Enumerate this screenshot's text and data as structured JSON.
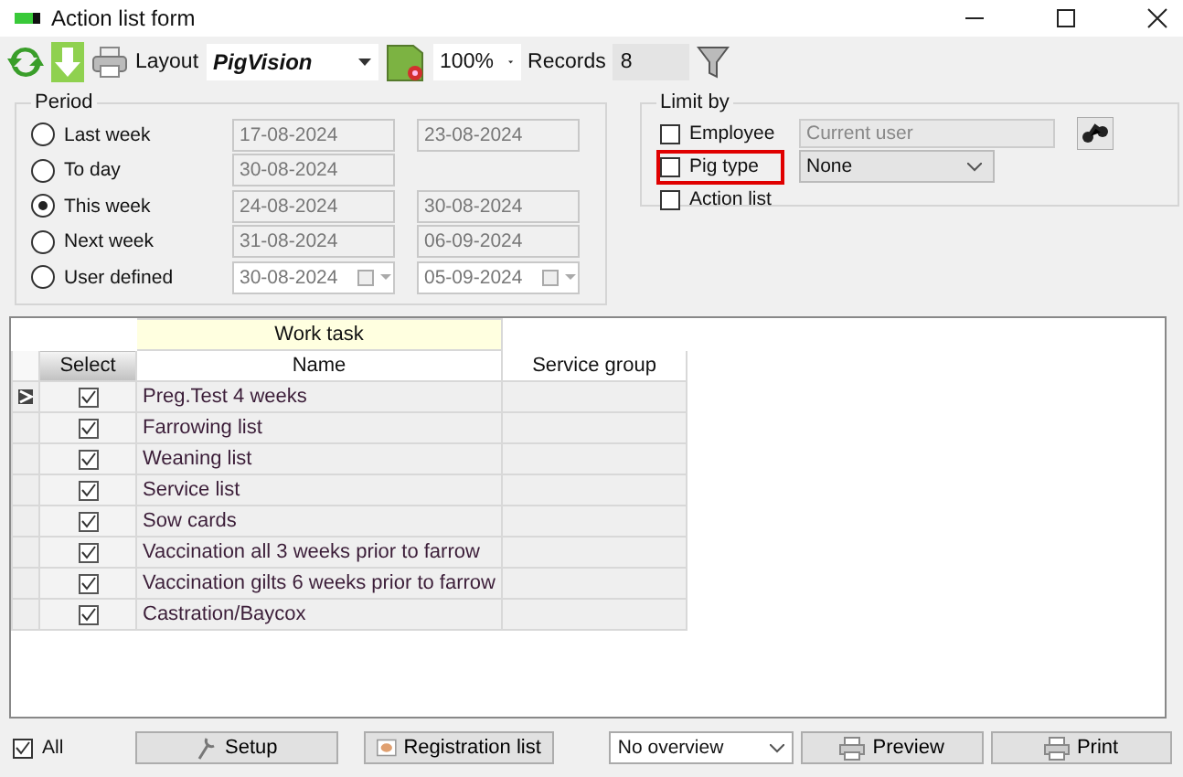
{
  "window": {
    "title": "Action list form"
  },
  "toolbar": {
    "layout_label": "Layout",
    "layout_value": "PigVision",
    "zoom_value": "100%",
    "records_label": "Records",
    "records_value": "8"
  },
  "period": {
    "title": "Period",
    "options": [
      {
        "label": "Last week",
        "selected": false,
        "from": "17-08-2024",
        "to": "23-08-2024",
        "editable": false
      },
      {
        "label": "To day",
        "selected": false,
        "from": "30-08-2024",
        "editable": false
      },
      {
        "label": "This week",
        "selected": true,
        "from": "24-08-2024",
        "to": "30-08-2024",
        "editable": false
      },
      {
        "label": "Next week",
        "selected": false,
        "from": "31-08-2024",
        "to": "06-09-2024",
        "editable": false
      },
      {
        "label": "User defined",
        "selected": false,
        "from": "30-08-2024",
        "to": "05-09-2024",
        "editable": true
      }
    ]
  },
  "limit_by": {
    "title": "Limit by",
    "items": [
      {
        "kind": "text",
        "label": "Employee",
        "checked": false,
        "highlighted": false,
        "placeholder": "Current user"
      },
      {
        "kind": "select",
        "label": "Pig type",
        "checked": false,
        "highlighted": true,
        "value": "None"
      },
      {
        "kind": "plain",
        "label": "Action list",
        "checked": false,
        "highlighted": false
      }
    ]
  },
  "table": {
    "group_header": "Work task",
    "columns": [
      "Select",
      "Name",
      "Service group"
    ],
    "rows": [
      {
        "checked": true,
        "name": "Preg.Test 4 weeks",
        "current": true
      },
      {
        "checked": true,
        "name": "Farrowing list",
        "current": false
      },
      {
        "checked": true,
        "name": "Weaning list",
        "current": false
      },
      {
        "checked": true,
        "name": "Service list",
        "current": false
      },
      {
        "checked": true,
        "name": "Sow cards",
        "current": false
      },
      {
        "checked": true,
        "name": "Vaccination all 3 weeks prior to farrow",
        "current": false
      },
      {
        "checked": true,
        "name": "Vaccination gilts 6 weeks prior to farrow",
        "current": false
      },
      {
        "checked": true,
        "name": "Castration/Baycox",
        "current": false
      }
    ]
  },
  "footer": {
    "all_label": "All",
    "all_checked": true,
    "setup": "Setup",
    "registration": "Registration list",
    "overview": "No overview",
    "preview": "Preview",
    "print": "Print"
  }
}
